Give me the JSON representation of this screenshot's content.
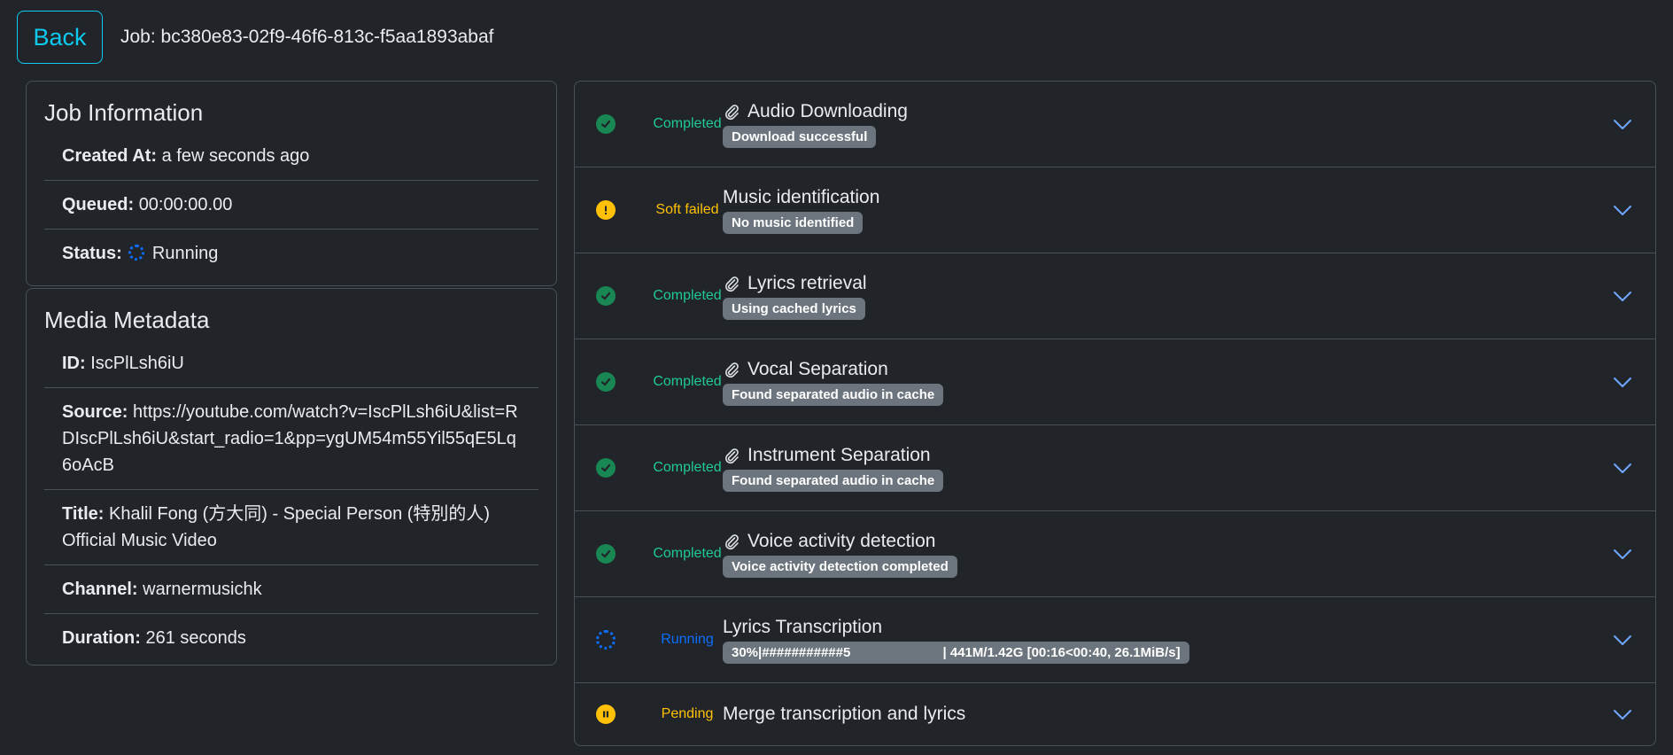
{
  "header": {
    "back_label": "Back",
    "job_label": "Job: bc380e83-02f9-46f6-813c-f5aa1893abaf"
  },
  "job_info": {
    "title": "Job Information",
    "created_label": "Created At:",
    "created_value": "a few seconds ago",
    "queued_label": "Queued:",
    "queued_value": "00:00:00.00",
    "status_label": "Status:",
    "status_value": "Running"
  },
  "media": {
    "title": "Media Metadata",
    "id_label": "ID:",
    "id_value": "IscPlLsh6iU",
    "source_label": "Source:",
    "source_value": "https://youtube.com/watch?v=IscPlLsh6iU&list=RDIscPlLsh6iU&start_radio=1&pp=ygUM54m55Yil55qE5Lq6oAcB",
    "title_label": "Title:",
    "title_value": "Khalil Fong (方大同) - Special Person (特別的人) Official Music Video",
    "channel_label": "Channel:",
    "channel_value": "warnermusichk",
    "duration_label": "Duration:",
    "duration_value": "261 seconds"
  },
  "colors": {
    "completed": "#198754",
    "completed_text": "#20c997",
    "soft_failed": "#ffc107",
    "running": "#0d6efd",
    "pending": "#ffc107",
    "accent": "#0dcaf0"
  },
  "steps": [
    {
      "status": "Completed",
      "icon": "check-icon",
      "title": "Audio Downloading",
      "has_clip": true,
      "badge": "Download successful"
    },
    {
      "status": "Soft failed",
      "icon": "warning-icon",
      "title": "Music identification",
      "has_clip": false,
      "badge": "No music identified"
    },
    {
      "status": "Completed",
      "icon": "check-icon",
      "title": "Lyrics retrieval",
      "has_clip": true,
      "badge": "Using cached lyrics"
    },
    {
      "status": "Completed",
      "icon": "check-icon",
      "title": "Vocal Separation",
      "has_clip": true,
      "badge": "Found separated audio in cache"
    },
    {
      "status": "Completed",
      "icon": "check-icon",
      "title": "Instrument Separation",
      "has_clip": true,
      "badge": "Found separated audio in cache"
    },
    {
      "status": "Completed",
      "icon": "check-icon",
      "title": "Voice activity detection",
      "has_clip": true,
      "badge": "Voice activity detection completed"
    },
    {
      "status": "Running",
      "icon": "spinner-icon",
      "title": "Lyrics Transcription",
      "has_clip": false,
      "badge": "30%|###########5                         | 441M/1.42G [00:16<00:40, 26.1MiB/s]"
    },
    {
      "status": "Pending",
      "icon": "pause-icon",
      "title": "Merge transcription and lyrics",
      "has_clip": false,
      "badge": ""
    }
  ]
}
